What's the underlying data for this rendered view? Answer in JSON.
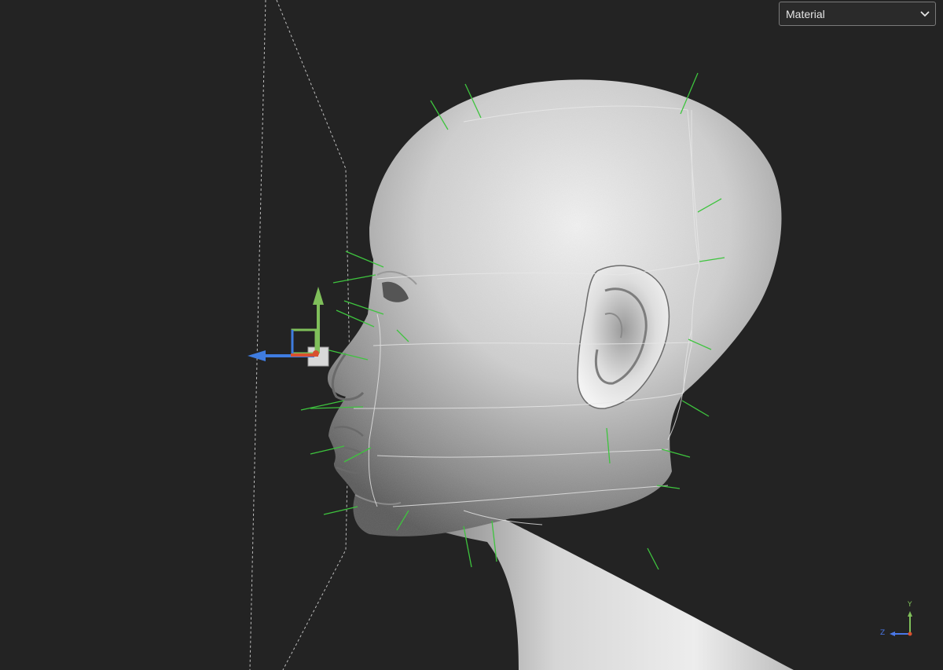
{
  "shading_mode": {
    "selected": "Material"
  },
  "axis_indicator": {
    "y_label": "Y",
    "z_label": "Z"
  },
  "colors": {
    "background": "#232323",
    "guide_lines": "#3ec43e",
    "axis_x": "#d9502e",
    "axis_y": "#7fbf5a",
    "axis_z": "#3f7ce0",
    "model": "#cfcfcf"
  }
}
